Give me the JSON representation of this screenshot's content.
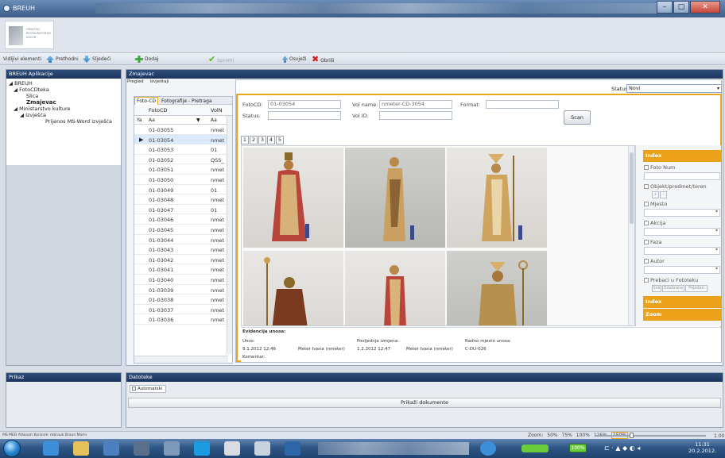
{
  "window": {
    "title": "BREUH"
  },
  "logo": {
    "text": "HRVATSKI RESTAURATORSKI ZAVOD"
  },
  "toolbar": {
    "items": [
      {
        "label": "Vidljivi elementi",
        "icon": ""
      },
      {
        "label": "Prethodni",
        "icon": "arrow-up-icon"
      },
      {
        "label": "Sljedeći",
        "icon": "arrow-down-icon"
      },
      {
        "label": "Dodaj",
        "icon": "add-icon"
      },
      {
        "label": "Spremi",
        "icon": "check-icon"
      },
      {
        "label": "Osvježi",
        "icon": "refresh-icon"
      },
      {
        "label": "Obriši",
        "icon": "delete-icon"
      }
    ]
  },
  "left_panel": {
    "title": "BREUH Aplikacije",
    "tree": [
      {
        "label": "BREUH",
        "level": 1
      },
      {
        "label": "FotoCDteka",
        "level": 2
      },
      {
        "label": "Slica",
        "level": 3
      },
      {
        "label": "Zmajevac",
        "level": 3
      },
      {
        "label": "Ministarstvo kulture",
        "level": 2
      },
      {
        "label": "Izvješća",
        "level": 3
      },
      {
        "label": "Prijenos MS-Word izvješća",
        "level": 4
      }
    ]
  },
  "main": {
    "title": "Zmajevac",
    "top_tabs": [
      "Pregled",
      "Izvještaji"
    ]
  },
  "list": {
    "tabs": [
      "Foto-CD",
      "Fotografije - Pretraga"
    ],
    "headers": {
      "code": "FotoCD",
      "vol": "VolN"
    },
    "filter": {
      "op1": "Aa",
      "op2": "Aa"
    },
    "rows": [
      {
        "code": "01-03055",
        "vol": "nmet"
      },
      {
        "code": "01-03054",
        "vol": "nmet",
        "selected": true
      },
      {
        "code": "01-03053",
        "vol": "01"
      },
      {
        "code": "01-03052",
        "vol": "QSS_"
      },
      {
        "code": "01-03051",
        "vol": "nmet"
      },
      {
        "code": "01-03050",
        "vol": "nmet"
      },
      {
        "code": "01-03049",
        "vol": "01"
      },
      {
        "code": "01-03048",
        "vol": "nmet"
      },
      {
        "code": "01-03047",
        "vol": "01"
      },
      {
        "code": "01-03046",
        "vol": "nmet"
      },
      {
        "code": "01-03045",
        "vol": "nmet"
      },
      {
        "code": "01-03044",
        "vol": "nmet"
      },
      {
        "code": "01-03043",
        "vol": "nmet"
      },
      {
        "code": "01-03042",
        "vol": "nmet"
      },
      {
        "code": "01-03041",
        "vol": "nmet"
      },
      {
        "code": "01-03040",
        "vol": "nmet"
      },
      {
        "code": "01-03039",
        "vol": "nmet"
      },
      {
        "code": "01-03038",
        "vol": "nmet"
      },
      {
        "code": "01-03037",
        "vol": "nmet"
      },
      {
        "code": "01-03036",
        "vol": "nmet"
      }
    ]
  },
  "detail": {
    "status_label": "Status",
    "status_value": "Novi",
    "fields": {
      "fotocd_label": "FotoCD:",
      "fotocd_value": "01-03054",
      "volname_label": "Vol name:",
      "volname_value": "nmeter-CD-3054",
      "format_label": "Format:",
      "status_label": "Status:",
      "volid_label": "Vol ID:"
    },
    "scan_label": "Scan",
    "pages": [
      "1",
      "2",
      "3",
      "4",
      "5"
    ],
    "index": {
      "title": "Index",
      "items": [
        "Foto Num",
        "Objekt/predmet/teren",
        "Mjesto",
        "Akcija",
        "Faza",
        "Autor",
        "Prebaci u Fototeku"
      ],
      "buttons": [
        "Sve",
        "Odabrane",
        "Pojedan"
      ],
      "index2": "Index",
      "zoom": "Zoom"
    },
    "evidence": {
      "title": "Evidencija unosa:",
      "unos_label": "Unos:",
      "unos_date": "9.1.2012 12:46",
      "unos_user": "Meter Ivana (nmeter)",
      "izmjena_label": "Posljednja izmjena:",
      "izmjena_date": "1.2.2012 12:47",
      "izmjena_user": "Meter Ivana (nmeter)",
      "radno_label": "Radno mjesto unosa:",
      "radno_value": "C-DU-026",
      "komentar_label": "Komentar:"
    }
  },
  "bottom": {
    "prikaz_title": "Prikaz",
    "datoteke_title": "Datoteke",
    "automatski": "Automatski",
    "prikazi_button": "Prikaži dokumente"
  },
  "statusbar": {
    "left": "MS MED Atlasom Korisnik: mbrauk Braun Marin",
    "zoom_label": "Zoom:",
    "zooms": [
      "50%",
      "75%",
      "100%",
      "125%",
      "150%"
    ],
    "zoom_value": "1.00"
  },
  "taskbar": {
    "badge": "100%",
    "time": "11:31",
    "date": "20.2.2012."
  }
}
